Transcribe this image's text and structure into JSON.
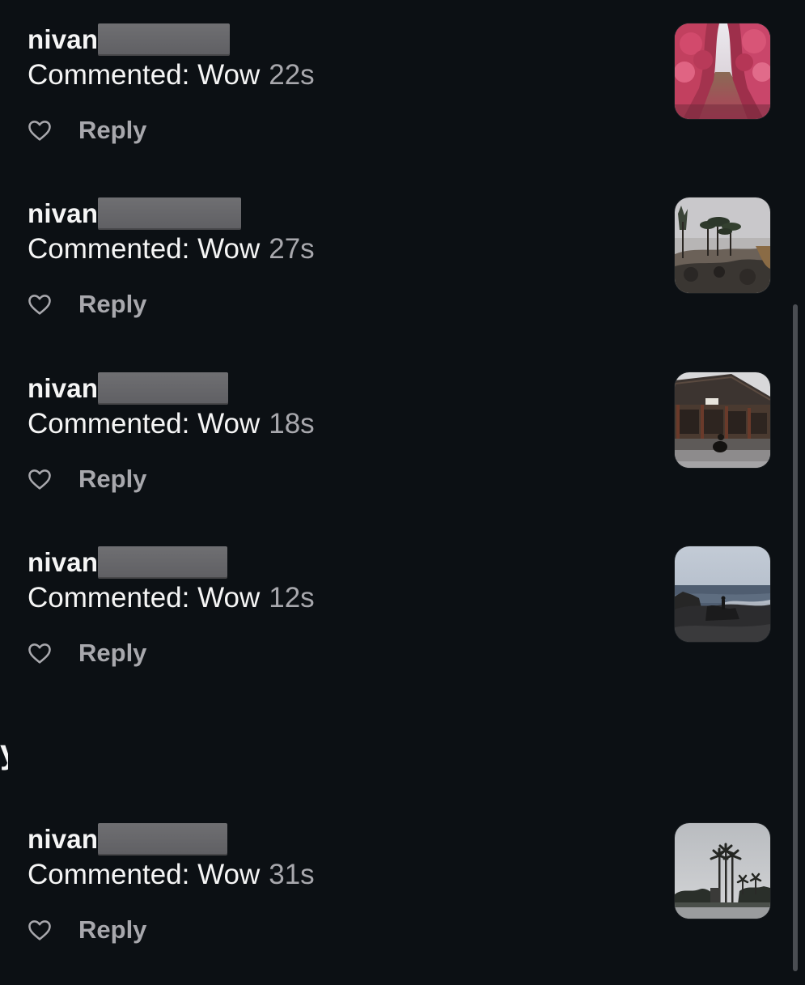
{
  "activity": {
    "items": [
      {
        "username": "nivan",
        "comment": "Commented: Wow",
        "time": "22s",
        "reply_label": "Reply",
        "thumbnail_icon": "pink-trees-path-photo"
      },
      {
        "username": "nivan",
        "comment": "Commented: Wow",
        "time": "27s",
        "reply_label": "Reply",
        "thumbnail_icon": "pine-trees-rocks-photo"
      },
      {
        "username": "nivan",
        "comment": "Commented: Wow",
        "time": "18s",
        "reply_label": "Reply",
        "thumbnail_icon": "traditional-building-photo"
      },
      {
        "username": "nivan",
        "comment": "Commented: Wow",
        "time": "12s",
        "reply_label": "Reply",
        "thumbnail_icon": "sea-rocks-photo"
      },
      {
        "username": "nivan",
        "comment": "Commented: Wow",
        "time": "31s",
        "reply_label": "Reply",
        "thumbnail_icon": "palm-trees-photo"
      }
    ],
    "edge_text": "y"
  },
  "colors": {
    "background": "#0c1014",
    "primary_text": "#f5f5f5",
    "secondary_text": "#a8a8ad",
    "redaction": "#66666a"
  }
}
